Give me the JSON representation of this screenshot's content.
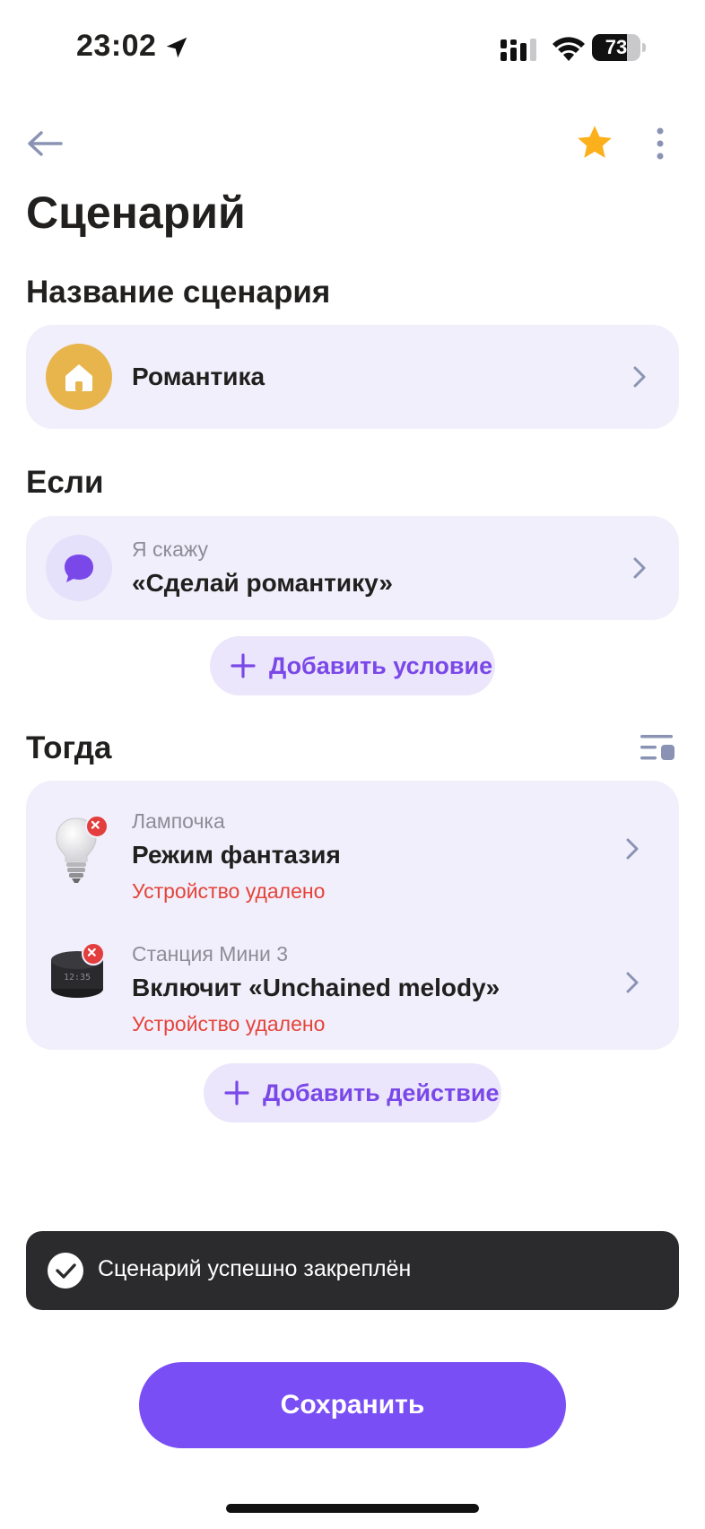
{
  "status_bar": {
    "time": "23:02",
    "battery": "73",
    "battery_level": 0.73
  },
  "header": {
    "title": "Сценарий"
  },
  "name_section": {
    "title": "Название сценария",
    "scenario_name": "Романтика",
    "icon": "home-icon",
    "icon_color": "#e8b54d"
  },
  "if_section": {
    "title": "Если",
    "condition": {
      "label": "Я скажу",
      "value": "«Сделай романтику»",
      "icon": "chat-bubble-icon",
      "icon_color": "#7a48e8"
    },
    "add_label": "Добавить условие"
  },
  "then_section": {
    "title": "Тогда",
    "actions": [
      {
        "device": "Лампочка",
        "action": "Режим фантазия",
        "status": "Устройство удалено",
        "icon": "lightbulb-icon"
      },
      {
        "device": "Станция Мини 3",
        "action": "Включит «Unchained melody»",
        "status": "Устройство удалено",
        "icon": "smart-speaker-icon"
      }
    ],
    "add_label": "Добавить действие"
  },
  "toast": {
    "text": "Сценарий успешно закреплён"
  },
  "save_label": "Сохранить",
  "colors": {
    "accent": "#7a4ef5",
    "card_bg": "#f1effb",
    "error": "#e5433a",
    "star": "#fbb01c"
  }
}
